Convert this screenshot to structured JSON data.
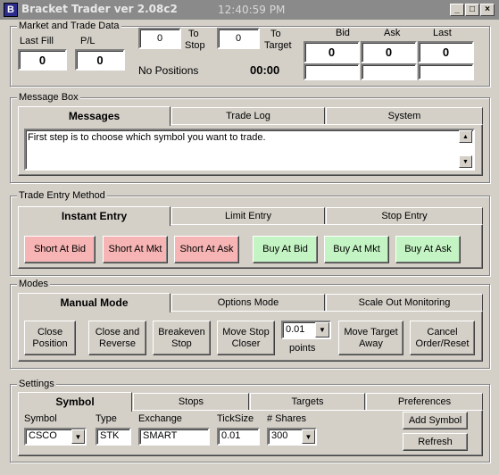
{
  "window": {
    "title": "Bracket Trader ver 2.08c2",
    "clock": "12:40:59 PM",
    "min_glyph": "_",
    "max_glyph": "□",
    "close_glyph": "×",
    "icon_glyph": "B"
  },
  "market": {
    "group_label": "Market and Trade Data",
    "last_fill_label": "Last Fill",
    "last_fill_value": "0",
    "pl_label": "P/L",
    "pl_value": "0",
    "to_stop_value": "0",
    "to_stop_label_1": "To",
    "to_stop_label_2": "Stop",
    "to_target_value": "0",
    "to_target_label_1": "To",
    "to_target_label_2": "Target",
    "positions_text": "No Positions",
    "timer": "00:00",
    "bid_label": "Bid",
    "bid_value": "0",
    "ask_label": "Ask",
    "ask_value": "0",
    "last_label": "Last",
    "last_value": "0"
  },
  "messages": {
    "group_label": "Message Box",
    "tabs": [
      "Messages",
      "Trade Log",
      "System"
    ],
    "text": "First step is to choose which symbol you want to trade."
  },
  "entry": {
    "group_label": "Trade Entry Method",
    "tabs": [
      "Instant Entry",
      "Limit Entry",
      "Stop Entry"
    ],
    "buttons": [
      "Short At Bid",
      "Short At Mkt",
      "Short At Ask",
      "Buy At Bid",
      "Buy At Mkt",
      "Buy At Ask"
    ]
  },
  "modes": {
    "group_label": "Modes",
    "tabs": [
      "Manual Mode",
      "Options Mode",
      "Scale Out Monitoring"
    ],
    "buttons": [
      {
        "l1": "Close",
        "l2": "Position"
      },
      {
        "l1": "Close and",
        "l2": "Reverse"
      },
      {
        "l1": "Breakeven",
        "l2": "Stop"
      },
      {
        "l1": "Move Stop",
        "l2": "Closer"
      },
      {
        "l1": "Move Target",
        "l2": "Away"
      },
      {
        "l1": "Cancel",
        "l2": "Order/Reset"
      }
    ],
    "points_value": "0.01",
    "points_label": "points"
  },
  "settings": {
    "group_label": "Settings",
    "tabs": [
      "Symbol",
      "Stops",
      "Targets",
      "Preferences"
    ],
    "symbol_label": "Symbol",
    "symbol_value": "CSCO",
    "type_label": "Type",
    "type_value": "STK",
    "exchange_label": "Exchange",
    "exchange_value": "SMART",
    "ticksize_label": "TickSize",
    "ticksize_value": "0.01",
    "shares_label": "# Shares",
    "shares_value": "300",
    "add_symbol": "Add Symbol",
    "refresh": "Refresh"
  }
}
